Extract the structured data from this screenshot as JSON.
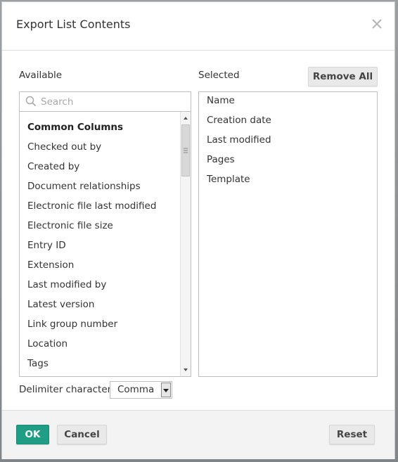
{
  "dialog": {
    "title": "Export List Contents",
    "close_icon": "close-icon"
  },
  "available": {
    "label": "Available",
    "search_placeholder": "Search",
    "search_value": "",
    "items": [
      {
        "label": "Common Columns",
        "header": true
      },
      {
        "label": "Checked out by"
      },
      {
        "label": "Created by"
      },
      {
        "label": "Document relationships"
      },
      {
        "label": "Electronic file last modified"
      },
      {
        "label": "Electronic file size"
      },
      {
        "label": "Entry ID"
      },
      {
        "label": "Extension"
      },
      {
        "label": "Last modified by"
      },
      {
        "label": "Latest version"
      },
      {
        "label": "Link group number"
      },
      {
        "label": "Location"
      },
      {
        "label": "Tags"
      }
    ]
  },
  "selected": {
    "label": "Selected",
    "remove_all_label": "Remove All",
    "items": [
      "Name",
      "Creation date",
      "Last modified",
      "Pages",
      "Template"
    ]
  },
  "delimiter": {
    "label": "Delimiter character",
    "value": "Comma"
  },
  "footer": {
    "ok_label": "OK",
    "cancel_label": "Cancel",
    "reset_label": "Reset"
  },
  "colors": {
    "primary": "#1f9e85",
    "button_gray": "#e9e9e9",
    "border": "#bfbfbf"
  }
}
